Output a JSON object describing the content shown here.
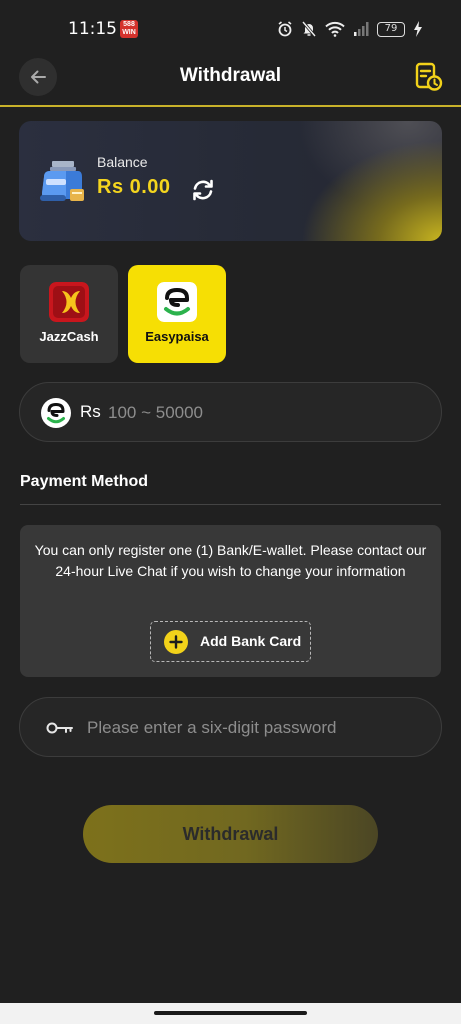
{
  "status_bar": {
    "time": "11:15",
    "app_badge": "588 WIN",
    "battery": "79",
    "icons": [
      "alarm-icon",
      "mute-icon",
      "wifi-icon",
      "signal-icon",
      "battery-icon",
      "charging-icon"
    ]
  },
  "header": {
    "title": "Withdrawal",
    "back_icon": "arrow-left-icon",
    "history_icon": "history-record-icon"
  },
  "balance": {
    "label": "Balance",
    "value": "Rs  0.00",
    "refresh_icon": "refresh-icon"
  },
  "methods": [
    {
      "name": "JazzCash",
      "selected": false
    },
    {
      "name": "Easypaisa",
      "selected": true
    }
  ],
  "amount": {
    "currency": "Rs",
    "placeholder": "100 ~ 50000",
    "value": ""
  },
  "payment_method": {
    "title": "Payment Method",
    "notice": "You can only register one (1) Bank/E-wallet. Please contact our 24-hour Live Chat if you wish to change your information",
    "add_card_label": "Add Bank Card"
  },
  "password": {
    "placeholder": "Please enter a six-digit password",
    "value": ""
  },
  "submit": {
    "label": "Withdrawal"
  },
  "colors": {
    "background": "#202020",
    "accent": "#f6df04",
    "balance_value": "#f4d51e",
    "field": "#262626",
    "card": "#383838"
  }
}
